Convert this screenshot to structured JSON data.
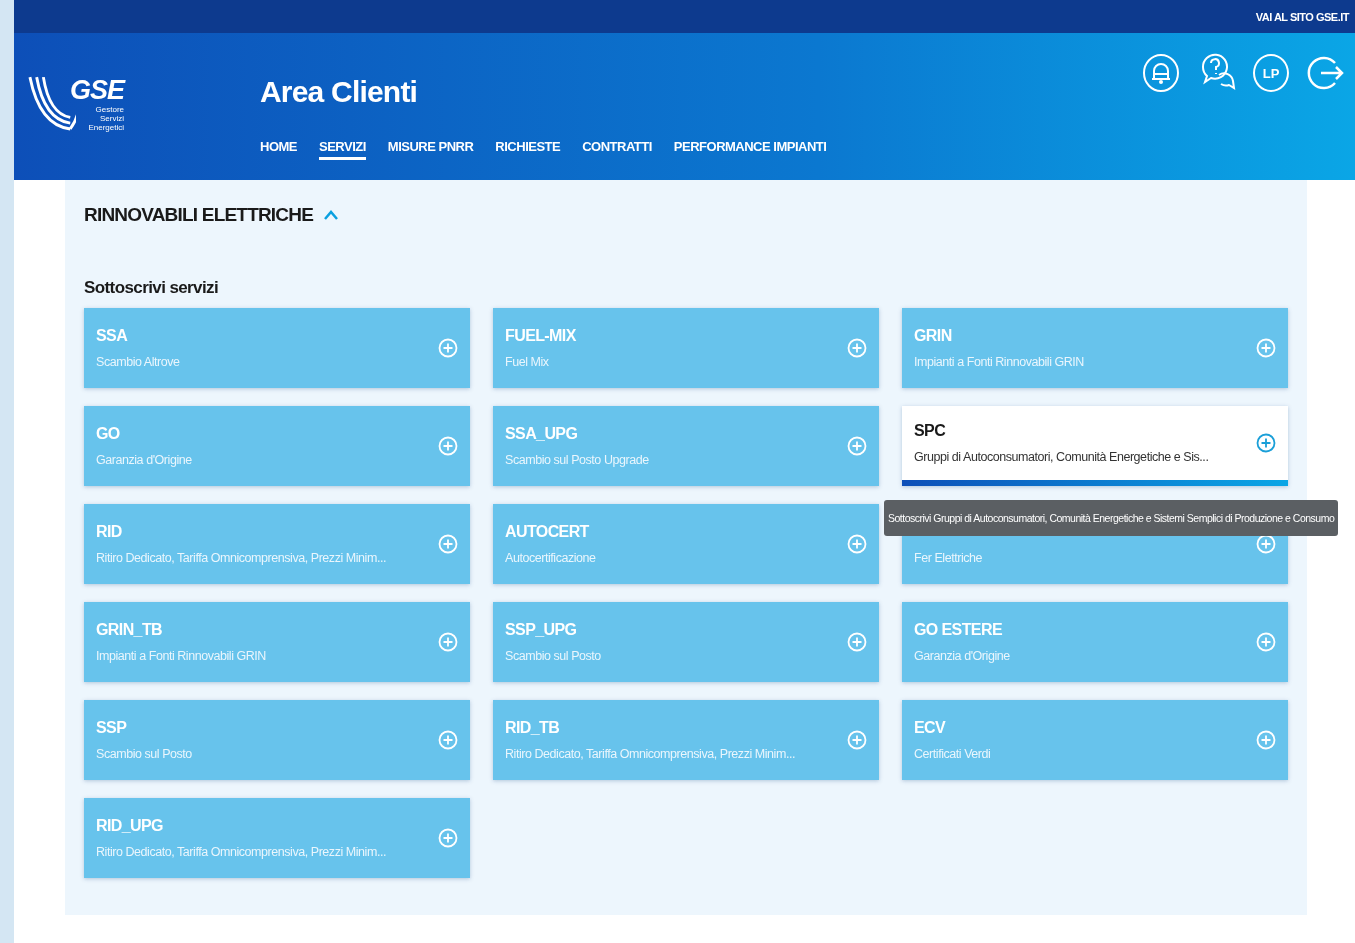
{
  "top_bar": {
    "link": "VAI AL SITO GSE.IT"
  },
  "header": {
    "logo": {
      "mark": "GSE",
      "lines": [
        "Gestore",
        "Servizi",
        "Energetici"
      ]
    },
    "title": "Area Clienti",
    "actions": [
      {
        "kind": "bell"
      },
      {
        "kind": "help"
      },
      {
        "kind": "avatar",
        "label": "LP"
      },
      {
        "kind": "logout"
      }
    ]
  },
  "nav": [
    {
      "label": "HOME",
      "selected": false
    },
    {
      "label": "SERVIZI",
      "selected": true
    },
    {
      "label": "MISURE PNRR",
      "selected": false
    },
    {
      "label": "RICHIESTE",
      "selected": false
    },
    {
      "label": "CONTRATTI",
      "selected": false
    },
    {
      "label": "PERFORMANCE IMPIANTI",
      "selected": false
    }
  ],
  "section": {
    "title": "RINNOVABILI ELETTRICHE",
    "expanded": true,
    "subtitle": "Sottoscrivi servizi"
  },
  "cards": [
    {
      "title": "SSA",
      "subtitle": "Scambio Altrove",
      "selected": false
    },
    {
      "title": "FUEL-MIX",
      "subtitle": "Fuel Mix",
      "selected": false
    },
    {
      "title": "GRIN",
      "subtitle": "Impianti a Fonti Rinnovabili GRIN",
      "selected": false
    },
    {
      "title": "GO",
      "subtitle": "Garanzia d'Origine",
      "selected": false
    },
    {
      "title": "SSA_UPG",
      "subtitle": "Scambio sul Posto Upgrade",
      "selected": false
    },
    {
      "title": "SPC",
      "subtitle": "Gruppi di Autoconsumatori, Comunità Energetiche e Sis...",
      "selected": true
    },
    {
      "title": "RID",
      "subtitle": "Ritiro Dedicato, Tariffa Omnicomprensiva, Prezzi Minim...",
      "selected": false
    },
    {
      "title": "AUTOCERT",
      "subtitle": "Autocertificazione",
      "selected": false
    },
    {
      "subtitle": "Fer Elettriche",
      "selected": false
    },
    {
      "title": "GRIN_TB",
      "subtitle": "Impianti a Fonti Rinnovabili GRIN",
      "selected": false
    },
    {
      "title": "SSP_UPG",
      "subtitle": "Scambio sul Posto",
      "selected": false
    },
    {
      "title": "GO ESTERE",
      "subtitle": "Garanzia d'Origine",
      "selected": false
    },
    {
      "title": "SSP",
      "subtitle": "Scambio sul Posto",
      "selected": false
    },
    {
      "title": "RID_TB",
      "subtitle": "Ritiro Dedicato, Tariffa Omnicomprensiva, Prezzi Minim...",
      "selected": false
    },
    {
      "title": "ECV",
      "subtitle": "Certificati Verdi",
      "selected": false
    },
    {
      "title": "RID_UPG",
      "subtitle": "Ritiro Dedicato, Tariffa Omnicomprensiva, Prezzi Minim...",
      "selected": false
    }
  ],
  "tooltip": "Sottoscrivi Gruppi di Autoconsumatori, Comunità Energetiche e Sistemi Semplici di Produzione e Consumo"
}
